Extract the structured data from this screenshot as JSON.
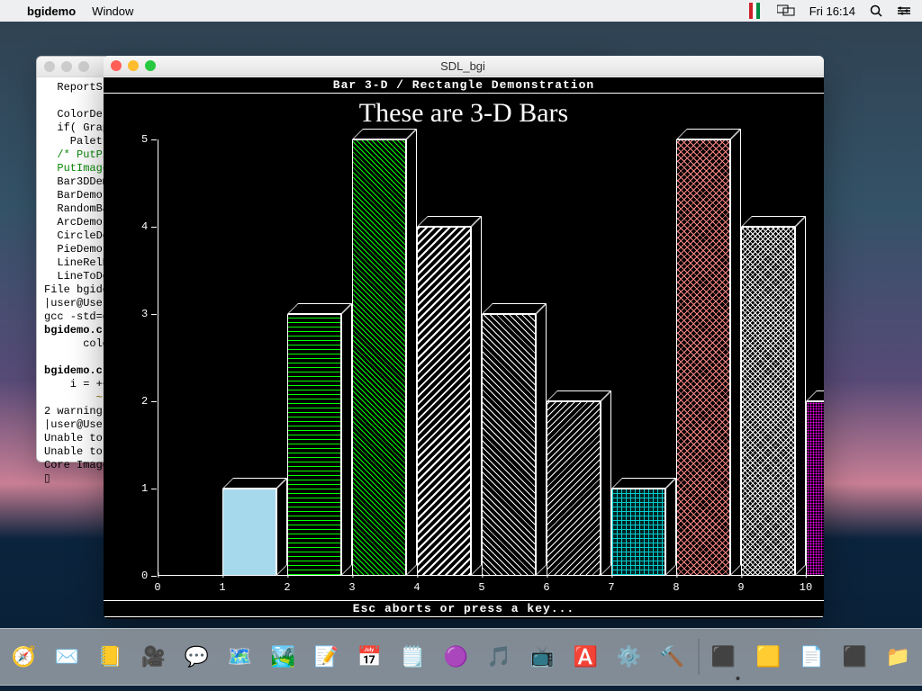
{
  "menubar": {
    "app_name": "bgidemo",
    "menu_window": "Window",
    "day_time": "Fri 16:14"
  },
  "terminal": {
    "lines": [
      "  ReportS",
      "",
      "  ColorDe",
      "  if( Grap",
      "    Palett",
      "  /* PutPi",
      "  PutImage",
      "  Bar3DDem",
      "  BarDemo(",
      "  RandomBa",
      "  ArcDemo(",
      "  CircleDe",
      "  PieDemo(",
      "  LineRelD",
      "  LineToDe",
      "File bgide",
      "|user@Users",
      "gcc -std=g",
      "bgidemo.c:",
      "      colo",
      "",
      "bgidemo.c:",
      "    i = ++",
      "        ~ ^",
      "2 warnings",
      "|user@Users",
      "Unable to ",
      "Unable to ",
      "Core Image",
      "▯"
    ]
  },
  "gfxwin": {
    "title": "SDL_bgi",
    "banner_top": "Bar 3-D / Rectangle Demonstration",
    "banner_bottom": "Esc aborts or press a key...",
    "chart_title": "These are 3-D Bars"
  },
  "chart_data": {
    "type": "bar",
    "title": "These are 3-D Bars",
    "categories": [
      "0",
      "1",
      "2",
      "3",
      "4",
      "5",
      "6",
      "7",
      "8",
      "9",
      "10"
    ],
    "values": [
      0,
      1,
      3,
      5,
      4,
      3,
      2,
      1,
      5,
      4,
      2
    ],
    "y_ticks": [
      0,
      1,
      2,
      3,
      4,
      5
    ],
    "xlabel": "",
    "ylabel": "",
    "xlim": [
      0,
      10
    ],
    "ylim": [
      0,
      5
    ],
    "bar_fills": [
      "",
      "fill-solid-cyan",
      "fill-hlines",
      "fill-diag-green",
      "fill-bkslash",
      "fill-ltslash",
      "fill-ltbkslash",
      "fill-cross-cyan",
      "fill-xhatch",
      "fill-interleave",
      "fill-closedot"
    ]
  },
  "dock": {
    "apps": [
      {
        "name": "finder",
        "emoji": "🔵",
        "running": true
      },
      {
        "name": "launchpad",
        "emoji": "🚀"
      },
      {
        "name": "safari",
        "emoji": "🧭"
      },
      {
        "name": "mail",
        "emoji": "✉️"
      },
      {
        "name": "contacts",
        "emoji": "📒"
      },
      {
        "name": "facetime",
        "emoji": "🎥"
      },
      {
        "name": "messages",
        "emoji": "💬"
      },
      {
        "name": "maps",
        "emoji": "🗺️"
      },
      {
        "name": "photos",
        "emoji": "🏞️"
      },
      {
        "name": "reminders",
        "emoji": "📝"
      },
      {
        "name": "calendar",
        "emoji": "📅"
      },
      {
        "name": "notes",
        "emoji": "🗒️"
      },
      {
        "name": "podcasts",
        "emoji": "🟣"
      },
      {
        "name": "music",
        "emoji": "🎵"
      },
      {
        "name": "appletv",
        "emoji": "📺"
      },
      {
        "name": "appstore",
        "emoji": "🅰️"
      },
      {
        "name": "system-preferences",
        "emoji": "⚙️"
      },
      {
        "name": "xcode",
        "emoji": "🔨"
      }
    ],
    "right": [
      {
        "name": "terminal",
        "emoji": "⬛",
        "running": true
      },
      {
        "name": "console",
        "emoji": "🟨"
      },
      {
        "name": "textedit",
        "emoji": "📄"
      },
      {
        "name": "activity",
        "emoji": "⬛"
      },
      {
        "name": "downloads",
        "emoji": "📁"
      },
      {
        "name": "bgi-window",
        "emoji": "🔲",
        "running": true
      },
      {
        "name": "trash",
        "emoji": "🗑️"
      }
    ]
  }
}
